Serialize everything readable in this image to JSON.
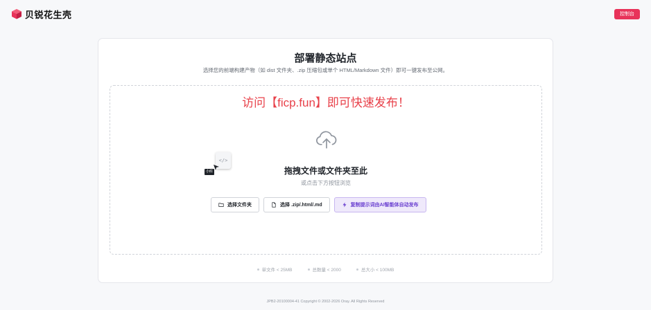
{
  "header": {
    "brand_name": "贝锐花生壳",
    "console_label": "控制台",
    "brand_color": "#e8335a"
  },
  "main": {
    "title": "部署静态站点",
    "subtitle": "选择您的前端构建产物（如 dist 文件夹、.zip 压缩包或单个 HTML/Markdown 文件）即可一键发布至公网。",
    "promo": "访问【ficp.fun】即可快速发布！",
    "drop_title": "拖拽文件或文件夹至此",
    "drop_hint": "或点击下方按钮浏览",
    "drag_badge": "小红",
    "code_glyph": "</>",
    "icons": [
      "upload-cloud-icon",
      "folder-icon",
      "file-icon",
      "bolt-icon",
      "cursor-icon"
    ],
    "buttons": {
      "folder": "选择文件夹",
      "file": "选择 .zip/.html/.md",
      "ai": "复制提示词由AI智能体自动发布"
    },
    "limits": [
      "单文件 < 25MB",
      "总数量 < 2000",
      "总大小 < 100MB"
    ]
  },
  "footer": {
    "text": "JPB2-20100004-41  Copyright © 2002-2026 Oray. All Rights Reserved"
  }
}
